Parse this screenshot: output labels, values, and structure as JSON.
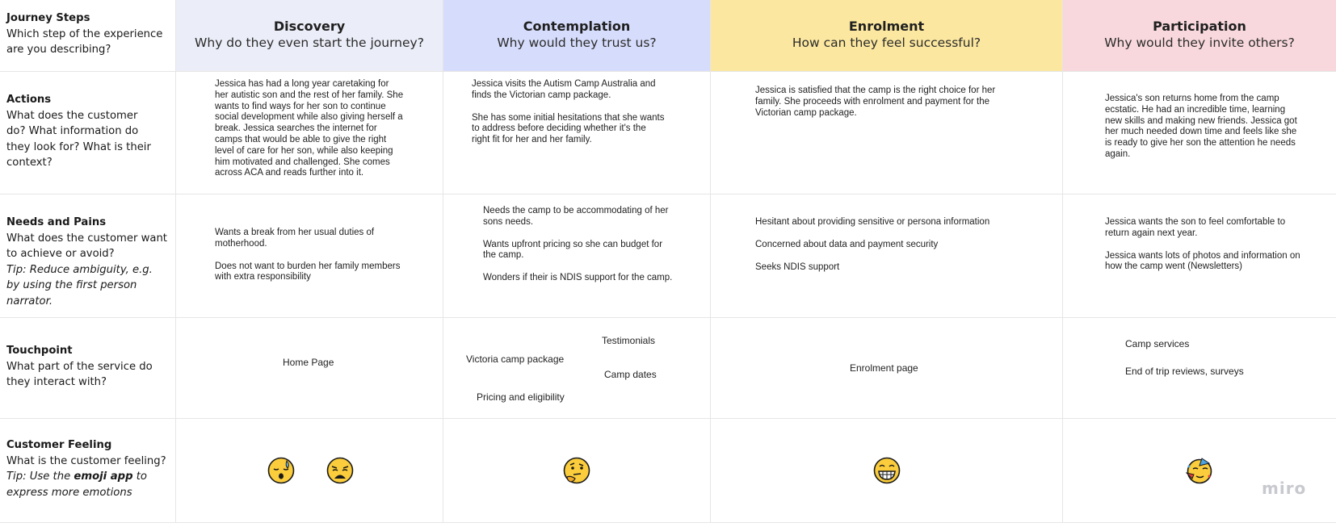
{
  "rows": {
    "steps": {
      "title": "Journey Steps",
      "desc": "Which step of the experience are you describing?"
    },
    "actions": {
      "title": "Actions",
      "desc": "What does the customer do? What information do they look for? What is their context?"
    },
    "needs": {
      "title": "Needs and Pains",
      "desc": "What does the customer want to achieve or avoid?",
      "tip": "Tip: Reduce ambiguity, e.g. by using the first person narrator."
    },
    "touchpoint": {
      "title": "Touchpoint",
      "desc": "What part of the service do they interact with?"
    },
    "feeling": {
      "title": "Customer Feeling",
      "desc": "What is the customer feeling?",
      "tip_pre": "Tip: Use the",
      "tip_bold": "emoji app",
      "tip_post": "to express more emotions"
    }
  },
  "columns": [
    {
      "stage": "Discovery",
      "question": "Why do they even start the journey?",
      "color": "#ebedf8"
    },
    {
      "stage": "Contemplation",
      "question": "Why would they trust us?",
      "color": "#d6dcfb"
    },
    {
      "stage": "Enrolment",
      "question": "How can they feel successful?",
      "color": "#fbe79f"
    },
    {
      "stage": "Participation",
      "question": "Why would they invite others?",
      "color": "#f8d8dc"
    }
  ],
  "actions": [
    [
      "Jessica has had a long year caretaking for her autistic son and the rest of her family. She wants to find ways for her son to continue social development while also giving herself a break. Jessica searches the internet for camps that would be able to give the right level of care for her son, while also keeping him motivated and challenged. She comes across ACA and reads further into it."
    ],
    [
      "Jessica visits the Autism Camp Australia and finds the Victorian camp package.",
      "She has some initial hesitations that she wants to address before deciding whether it's the right fit for her and her family."
    ],
    [
      "Jessica is satisfied that the camp is the right choice for her family. She proceeds with enrolment and payment for the Victorian camp package."
    ],
    [
      "Jessica's son returns home from the camp ecstatic. He had an incredible time, learning new skills and making new friends. Jessica got her much needed down time and feels like she is ready to give her son the attention he needs again."
    ]
  ],
  "needs": [
    [
      "Wants a break from her usual duties of motherhood.",
      "Does not want to burden her family members with extra responsibility"
    ],
    [
      "Needs the camp to be accommodating of her sons needs.",
      "Wants upfront pricing so she can budget for the camp.",
      "Wonders if their is NDIS support for the camp."
    ],
    [
      "Hesitant about providing sensitive or persona information",
      "Concerned about data and payment security",
      "Seeks NDIS support"
    ],
    [
      "Jessica wants the son to feel comfortable to return again next year.",
      "Jessica wants lots of photos and information on how the camp went (Newsletters)"
    ]
  ],
  "touchpoints": {
    "discovery": [
      "Home Page"
    ],
    "contemplation": [
      "Testimonials",
      "Victoria camp package",
      "Camp dates",
      "Pricing and eligibility"
    ],
    "enrolment": [
      "Enrolment page"
    ],
    "participation": [
      "Camp services",
      "End of trip reviews, surveys"
    ]
  },
  "feelings": {
    "discovery": [
      "sleepy-face-icon",
      "weary-face-icon"
    ],
    "contemplation": [
      "thinking-face-icon"
    ],
    "enrolment": [
      "grinning-face-icon"
    ],
    "participation": [
      "partying-face-icon"
    ]
  },
  "brand": "miro"
}
